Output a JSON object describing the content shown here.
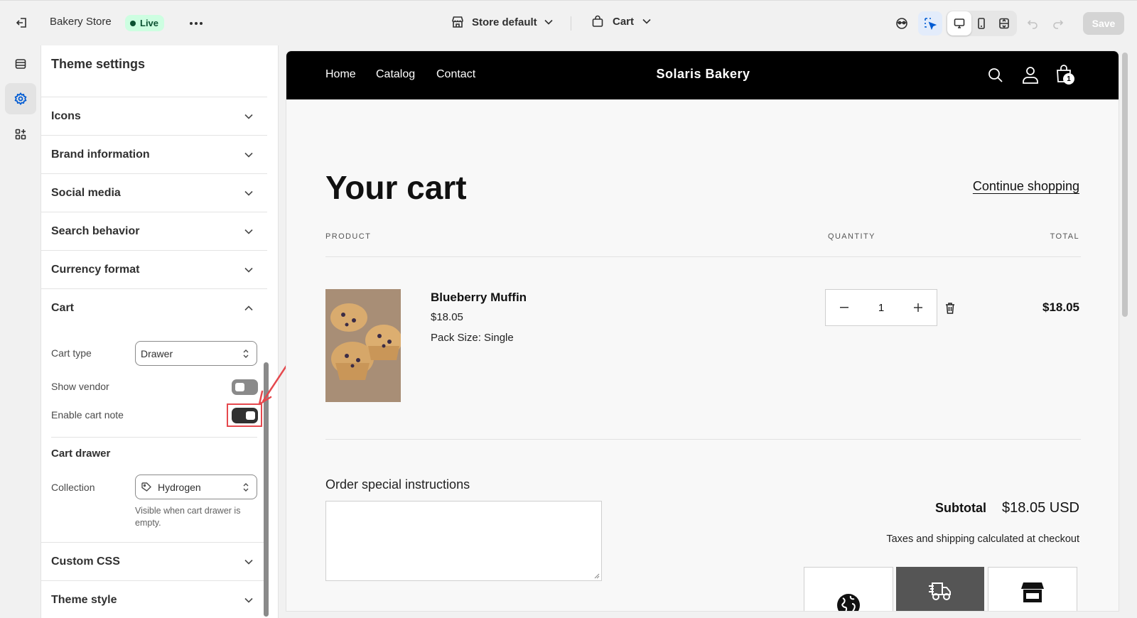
{
  "topbar": {
    "store_name": "Bakery Store",
    "live_badge": "Live",
    "store_selector": "Store default",
    "page_selector": "Cart",
    "save_label": "Save"
  },
  "sidebar": {
    "title": "Theme settings",
    "sections": [
      {
        "label": "Icons",
        "expanded": false
      },
      {
        "label": "Brand information",
        "expanded": false
      },
      {
        "label": "Social media",
        "expanded": false
      },
      {
        "label": "Search behavior",
        "expanded": false
      },
      {
        "label": "Currency format",
        "expanded": false
      },
      {
        "label": "Cart",
        "expanded": true
      },
      {
        "label": "Custom CSS",
        "expanded": false
      },
      {
        "label": "Theme style",
        "expanded": false
      }
    ],
    "cart": {
      "cart_type_label": "Cart type",
      "cart_type_value": "Drawer",
      "show_vendor_label": "Show vendor",
      "show_vendor_on": false,
      "cart_note_label": "Enable cart note",
      "cart_note_on": true,
      "drawer_heading": "Cart drawer",
      "collection_label": "Collection",
      "collection_value": "Hydrogen",
      "collection_help": "Visible when cart drawer is empty."
    }
  },
  "preview": {
    "nav": [
      "Home",
      "Catalog",
      "Contact"
    ],
    "brand": "Solaris Bakery",
    "cart_count": "1",
    "title": "Your cart",
    "continue": "Continue shopping",
    "col_product": "PRODUCT",
    "col_quantity": "QUANTITY",
    "col_total": "TOTAL",
    "item": {
      "name": "Blueberry Muffin",
      "price": "$18.05",
      "variant": "Pack Size: Single",
      "qty": "1",
      "total": "$18.05"
    },
    "instructions_label": "Order special instructions",
    "subtotal_label": "Subtotal",
    "subtotal_value": "$18.05 USD",
    "tax_note": "Taxes and shipping calculated at checkout"
  },
  "colors": {
    "accent": "#005bd3",
    "live_bg": "#cdfee1",
    "annotation": "#e5484d"
  }
}
